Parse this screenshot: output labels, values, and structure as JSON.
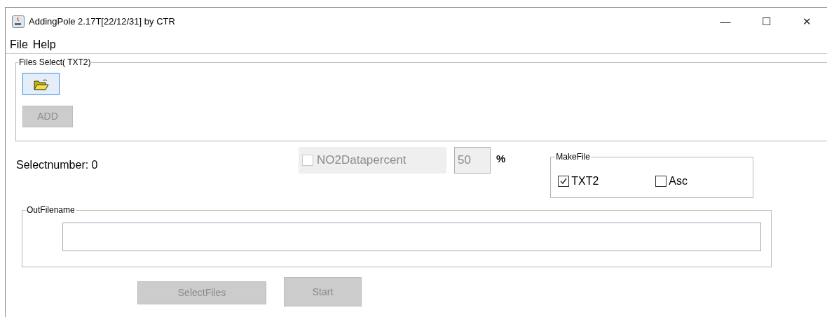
{
  "window": {
    "title": "AddingPole 2.17T[22/12/31] by CTR",
    "controls": [
      "—",
      "☐",
      "✕"
    ]
  },
  "menu": [
    "File",
    "Help"
  ],
  "files_select": {
    "legend": "Files Select( TXT2)",
    "add_button": {
      "label": "ADD",
      "disabled": true
    }
  },
  "select_number": "Selectnumber: 0",
  "no2": {
    "label": "NO2Datapercent",
    "checked": false,
    "disabled": true,
    "value": "50",
    "unit": "%"
  },
  "make_file": {
    "legend": "MakeFile",
    "options": [
      {
        "label": "TXT2",
        "checked": true
      },
      {
        "label": "Asc",
        "checked": false
      }
    ]
  },
  "out_filename": {
    "legend": "OutFilename"
  },
  "buttons": [
    {
      "label": "SelectFiles",
      "disabled": true
    },
    {
      "label": "Start",
      "disabled": true
    }
  ]
}
